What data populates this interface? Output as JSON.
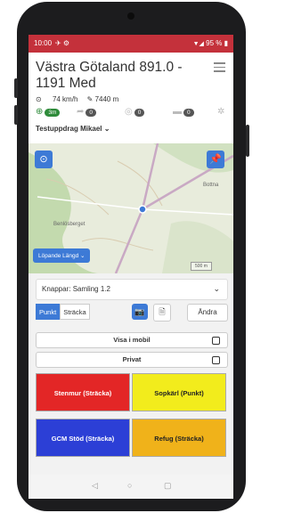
{
  "status": {
    "time": "10:00",
    "battery": "95 %"
  },
  "header": {
    "title": "Västra Götaland 891.0 - 1191 Med",
    "speed": "74 km/h",
    "distance": "7440 m",
    "accuracy": "3m",
    "counts": [
      "0",
      "0",
      "0"
    ],
    "collector": "Testuppdrag Mikael"
  },
  "map": {
    "place_labels": [
      "Benlösberget",
      "Bottna"
    ],
    "distance_button": "Löpande Längd",
    "scale_label": "500 m"
  },
  "controls": {
    "knappar": "Knappar: Samling 1.2",
    "mode_point": "Punkt",
    "mode_line": "Sträcka",
    "edit": "Ändra",
    "show_mobile": "Visa i mobil",
    "private": "Privat"
  },
  "buttons": [
    {
      "label": "Stenmur (Sträcka)",
      "color": "#e32626"
    },
    {
      "label": "Sopkärl (Punkt)",
      "color": "#f2ec1c"
    },
    {
      "label": "GCM Stöd (Sträcka)",
      "color": "#2c3fd6"
    },
    {
      "label": "Refug (Sträcka)",
      "color": "#f0b21a"
    }
  ],
  "colors": {
    "statusbar": "#c4313b",
    "accent": "#3d7ad6"
  },
  "icons": [
    "wifi-icon",
    "signal-icon",
    "battery-icon",
    "gps-icon",
    "speed-icon",
    "distance-icon",
    "camera-icon",
    "document-icon",
    "locate-icon",
    "pin-icon",
    "chevron-down-icon",
    "menu-icon",
    "settings-icon"
  ]
}
